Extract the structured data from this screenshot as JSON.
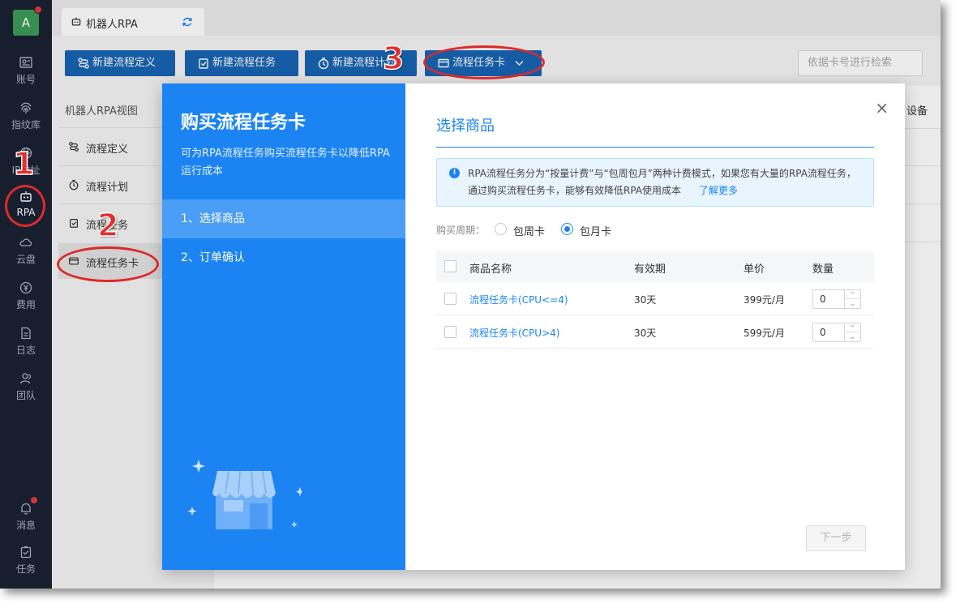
{
  "nav": {
    "avatar": "A",
    "items": [
      {
        "label": "账号",
        "icon": "id-card-icon"
      },
      {
        "label": "指纹库",
        "icon": "fingerprint-icon"
      },
      {
        "label": "IP地址",
        "icon": "globe-icon"
      },
      {
        "label": "RPA",
        "icon": "robot-icon"
      },
      {
        "label": "云盘",
        "icon": "cloud-icon"
      },
      {
        "label": "费用",
        "icon": "yen-icon"
      },
      {
        "label": "日志",
        "icon": "log-icon"
      },
      {
        "label": "团队",
        "icon": "team-icon"
      },
      {
        "label": "消息",
        "icon": "bell-icon"
      },
      {
        "label": "任务",
        "icon": "task-icon"
      }
    ]
  },
  "tab": {
    "label": "机器人RPA"
  },
  "toolbar": {
    "buttons": [
      {
        "label": "新建流程定义"
      },
      {
        "label": "新建流程任务"
      },
      {
        "label": "新建流程计划"
      },
      {
        "label": "流程任务卡"
      }
    ],
    "search_placeholder": "依据卡号进行检索"
  },
  "sidebar": {
    "title": "机器人RPA视图",
    "items": [
      {
        "label": "流程定义"
      },
      {
        "label": "流程计划"
      },
      {
        "label": "流程任务"
      },
      {
        "label": "流程任务卡"
      }
    ]
  },
  "main": {
    "column_hint": "设备"
  },
  "annotations": [
    "1",
    "2",
    "3"
  ],
  "dialog": {
    "title": "购买流程任务卡",
    "description": "可为RPA流程任务购买流程任务卡以降低RPA运行成本",
    "steps": [
      {
        "label": "1、选择商品"
      },
      {
        "label": "2、订单确认"
      }
    ],
    "section_title": "选择商品",
    "info_text": "RPA流程任务分为“按量计费”与“包周包月”两种计费模式，如果您有大量的RPA流程任务，通过购买流程任务卡，能够有效降低RPA使用成本",
    "learn_more": "了解更多",
    "period_label": "购买周期：",
    "period_options": [
      {
        "label": "包周卡",
        "selected": false
      },
      {
        "label": "包月卡",
        "selected": true
      }
    ],
    "table": {
      "headers": [
        "商品名称",
        "有效期",
        "单价",
        "数量"
      ],
      "rows": [
        {
          "name": "流程任务卡(CPU<=4)",
          "validity": "30天",
          "price": "399元/月",
          "qty": "0"
        },
        {
          "name": "流程任务卡(CPU>4)",
          "validity": "30天",
          "price": "599元/月",
          "qty": "0"
        }
      ]
    },
    "next_button": "下一步",
    "close_symbol": "×"
  },
  "colors": {
    "primary": "#1b84f2",
    "toolbar_button": "#1864b4",
    "nav_bg": "#1a2233",
    "annotation": "#e0312d"
  }
}
